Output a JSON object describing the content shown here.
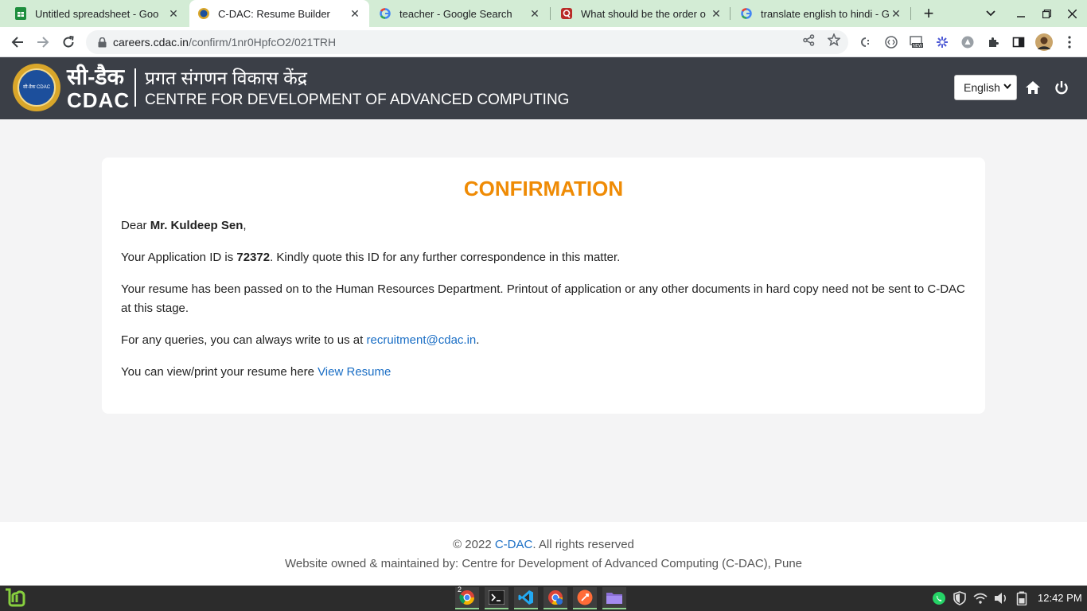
{
  "browser": {
    "tabs": [
      {
        "title": "Untitled spreadsheet - Goo",
        "icon": "sheets-icon",
        "active": false
      },
      {
        "title": "C-DAC: Resume Builder",
        "icon": "cdac-favicon-icon",
        "active": true
      },
      {
        "title": "teacher - Google Search",
        "icon": "google-icon",
        "active": false
      },
      {
        "title": "What should be the order o",
        "icon": "quora-icon",
        "active": false
      },
      {
        "title": "translate english to hindi - G",
        "icon": "google-icon",
        "active": false
      }
    ],
    "close_glyph": "✕",
    "new_tab_glyph": "+",
    "url_host": "careers.cdac.in",
    "url_path": "/confirm/1nr0HpfcO2/021TRH"
  },
  "header": {
    "hindi_brand": "सी-डैक",
    "brand": "CDAC",
    "hindi_name": "प्रगत संगणन विकास केंद्र",
    "english_name": "CENTRE FOR DEVELOPMENT OF ADVANCED COMPUTING",
    "seal_text": "सी-डैक CDAC",
    "language_selected": "English",
    "colors": {
      "bg": "#3b3f47",
      "seal": "#d9a62a"
    }
  },
  "confirmation": {
    "title": "CONFIRMATION",
    "dear_prefix": "Dear ",
    "candidate_name": "Mr. Kuldeep Sen",
    "dear_suffix": ",",
    "app_id_prefix": "Your Application ID is ",
    "application_id": "72372",
    "app_id_suffix": ". Kindly quote this ID for any further correspondence in this matter.",
    "resume_text": "Your resume has been passed on to the Human Resources Department. Printout of application or any other documents in hard copy need not be sent to C-DAC at this stage.",
    "query_prefix": "For any queries, you can always write to us at ",
    "email": "recruitment@cdac.in",
    "query_suffix": ".",
    "view_prefix": "You can view/print your resume here ",
    "view_link": "View Resume",
    "colors": {
      "title": "#ef8b05",
      "link": "#1a6ec5"
    }
  },
  "footer": {
    "copyright": "© 2022 ",
    "org_link": "C-DAC",
    "rights": ". All rights reserved",
    "maintained": "Website owned & maintained by: Centre for Development of Advanced Computing (C-DAC), Pune"
  },
  "taskbar": {
    "clock": "12:42 PM",
    "badge": "2"
  }
}
